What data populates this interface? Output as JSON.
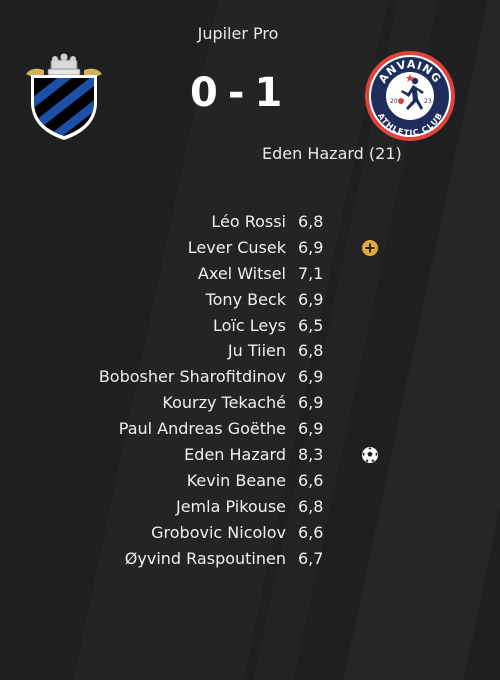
{
  "competition": "Jupiler Pro",
  "home_team": {
    "crest_icon": "club-brugge-crest-icon",
    "goals": "0",
    "colors": [
      "#000000",
      "#1b4fa8",
      "#ffffff",
      "#d4b25c"
    ]
  },
  "score_separator": "-",
  "away_team": {
    "crest_icon": "athletic-club-anvaing-crest-icon",
    "crest_top_text": "ANVAING",
    "crest_bottom_text": "ATHLETIC CLUB",
    "crest_year_left": "20",
    "crest_year_right": "23",
    "goals": "1",
    "colors": [
      "#1f2d5c",
      "#e0423c",
      "#ffffff"
    ]
  },
  "goal_scorer": "Eden Hazard (21)",
  "players": [
    {
      "name": "Léo Rossi",
      "rating": "6,8",
      "event": null
    },
    {
      "name": "Lever Cusek",
      "rating": "6,9",
      "event": "substitution-plus-icon"
    },
    {
      "name": "Axel Witsel",
      "rating": "7,1",
      "event": null
    },
    {
      "name": "Tony Beck",
      "rating": "6,9",
      "event": null
    },
    {
      "name": "Loïc Leys",
      "rating": "6,5",
      "event": null
    },
    {
      "name": "Ju Tiien",
      "rating": "6,8",
      "event": null
    },
    {
      "name": "Bobosher Sharofitdinov",
      "rating": "6,9",
      "event": null
    },
    {
      "name": "Kourzy Tekaché",
      "rating": "6,9",
      "event": null
    },
    {
      "name": "Paul Andreas Goëthe",
      "rating": "6,9",
      "event": null
    },
    {
      "name": "Eden Hazard",
      "rating": "8,3",
      "event": "soccer-ball-icon"
    },
    {
      "name": "Kevin Beane",
      "rating": "6,6",
      "event": null
    },
    {
      "name": "Jemla Pikouse",
      "rating": "6,8",
      "event": null
    },
    {
      "name": "Grobovic Nicolov",
      "rating": "6,6",
      "event": null
    },
    {
      "name": "Øyvind Raspoutinen",
      "rating": "6,7",
      "event": null
    }
  ],
  "colors": {
    "background": "#1f1f21",
    "text": "#f0f0f0",
    "substitution_icon": "#e8a93a"
  }
}
